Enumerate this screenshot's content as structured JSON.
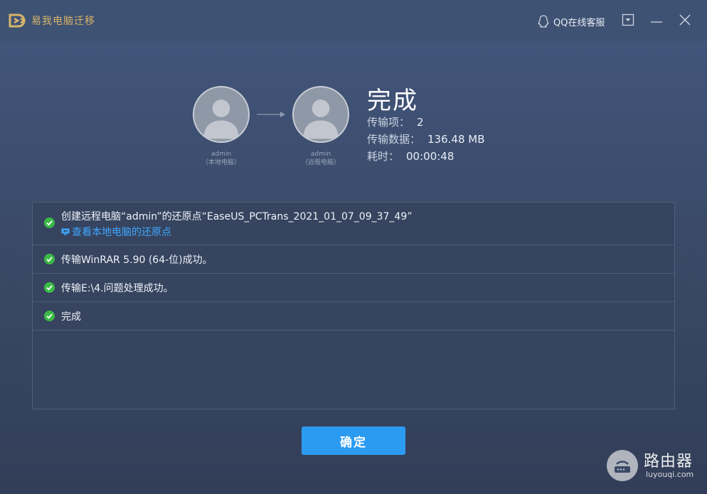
{
  "window": {
    "title": "易我电脑迁移",
    "qq_service_label": "QQ在线客服",
    "accent_color": "#d7b46a"
  },
  "devices": {
    "local": {
      "name": "admin",
      "role": "（本地电脑）"
    },
    "remote": {
      "name": "admin",
      "role": "（远程电脑）"
    }
  },
  "result": {
    "title": "完成",
    "items_label": "传输项：",
    "items_value": "2",
    "data_label": "传输数据：",
    "data_value": "136.48 MB",
    "time_label": "耗时：",
    "time_value": "00:00:48"
  },
  "log": [
    {
      "text": "创建远程电脑“admin”的还原点“EaseUS_PCTrans_2021_01_07_09_37_49”",
      "link": "查看本地电脑的还原点",
      "status": "success"
    },
    {
      "text": "传输WinRAR 5.90 (64-位)成功。",
      "status": "success"
    },
    {
      "text": "传输E:\\4.问题处理成功。",
      "status": "success"
    },
    {
      "text": "完成",
      "status": "success"
    }
  ],
  "confirm_label": "确定",
  "watermark": {
    "title": "路由器",
    "url": "luyouqi.com"
  },
  "colors": {
    "success": "#3cba46",
    "primary_button": "#2b9bf2",
    "link": "#3fa7ff"
  }
}
